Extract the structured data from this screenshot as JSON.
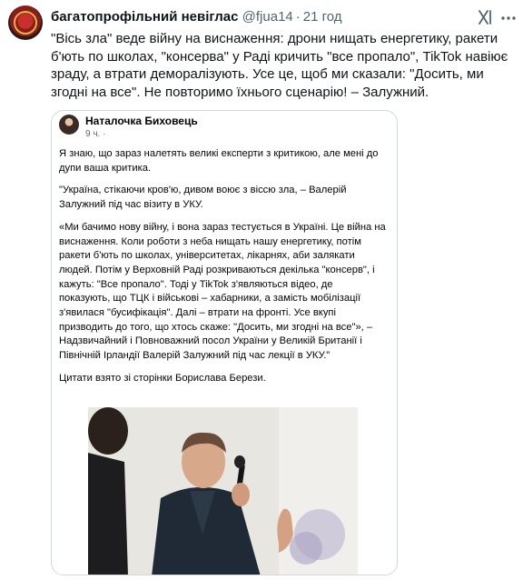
{
  "tweet": {
    "author_name": "багатопрофільний невіглас",
    "handle": "@fjua14",
    "separator": "·",
    "time": "21 год",
    "text": "\"Вісь зла\" веде війну на виснаження: дрони нищать енергетику, ракети б'ють по школах, \"консерва\" у Раді кричить \"все пропало\", TikTok навіює зраду, а втрати деморалізують. Усе це, щоб ми сказали: \"Досить, ми згодні на все\". Не повторимо їхнього сценарію! – Залужний."
  },
  "icons": {
    "avatar": "avatar-image",
    "grok": "grok-icon",
    "more": "more-icon"
  },
  "embedded_post": {
    "author_name": "Наталочка Биховець",
    "meta": "9 ч. ·",
    "paragraphs": [
      "Я знаю, що зараз налетять великі експерти з критикою, але мені до дупи ваша критика.",
      "\"Україна, стікаючи кров'ю, дивом воює з віссю зла, – Валерій Залужний під час візиту в УКУ.",
      "«Ми бачимо нову війну, і вона зараз тестується в Україні. Це війна на виснаження. Коли роботи з неба нищать нашу енергетику, потім ракети б'ють по школах, університетах, лікарнях, аби залякати людей. Потім у Верховній Раді розкриваються декілька \"консерв\", і кажуть: \"Все пропало\". Тоді у TikTok з'являються відео, де показують, що ТЦК і військові – хабарники, а замість мобілізації з'явилася \"бусифікація\". Далі – втрати на фронті. Усе вкупі призводить до того, що хтось скаже: \"Досить, ми згодні на все\"», – Надзвичайний і Повноважний посол України у Великій Британії і Північній Ірландії Валерій Залужний під час лекції в УКУ.\"",
      "Цитати взято зі сторінки Борислава Берези."
    ]
  },
  "colors": {
    "text_primary": "#0f1419",
    "text_secondary": "#536471",
    "border": "#cfd9de",
    "fb_meta": "#65676b"
  }
}
